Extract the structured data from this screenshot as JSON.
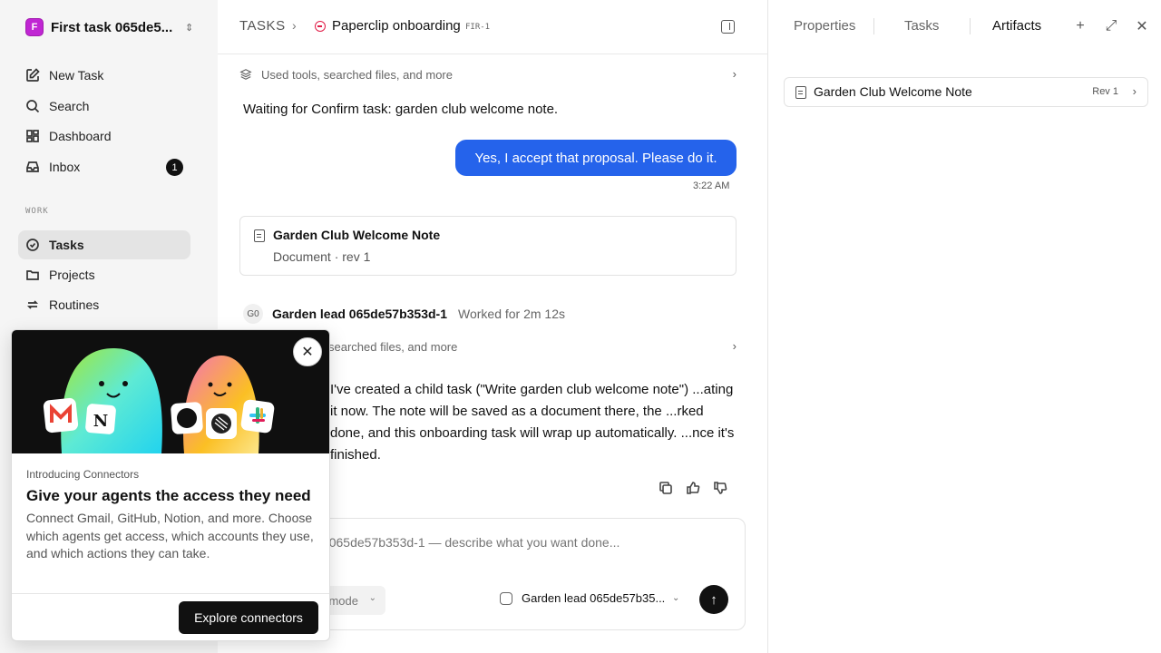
{
  "workspace": {
    "logo_letter": "F",
    "name": "First task 065de5..."
  },
  "sidebar": {
    "items": [
      {
        "label": "New Task",
        "icon": "edit-icon"
      },
      {
        "label": "Search",
        "icon": "search-icon"
      },
      {
        "label": "Dashboard",
        "icon": "dashboard-icon"
      },
      {
        "label": "Inbox",
        "icon": "inbox-icon",
        "badge": "1"
      }
    ],
    "section_label": "WORK",
    "work_items": [
      {
        "label": "Tasks",
        "icon": "check-circle-icon",
        "active": true
      },
      {
        "label": "Projects",
        "icon": "folder-icon"
      },
      {
        "label": "Routines",
        "icon": "repeat-icon"
      }
    ]
  },
  "header": {
    "breadcrumb_root": "TASKS",
    "task_title": "Paperclip onboarding",
    "task_id": "FIR-1",
    "status_color": "#e11d48"
  },
  "thread": {
    "tool_summary_1": "Used tools, searched files, and more",
    "waiting_text": "Waiting for Confirm task: garden club welcome note.",
    "user_message": "Yes, I accept that proposal. Please do it.",
    "user_message_time": "3:22 AM",
    "user_bubble_color": "#2563eb",
    "document_card": {
      "title": "Garden Club Welcome Note",
      "subtitle": "Document · rev 1"
    },
    "agent": {
      "initials": "G0",
      "name": "Garden lead 065de57b353d-1",
      "worked": "Worked for 2m 12s"
    },
    "tool_summary_2": "searched files, and more",
    "agent_message": "I've created a child task (\"Write garden club welcome note\") ...ating it now. The note will be saved as a document there, the ...rked done, and this onboarding task will wrap up automatically. ...nce it's finished."
  },
  "composer": {
    "placeholder": "...arden lead 065de57b353d-1 — describe what you want done...",
    "mode_label": "mode",
    "agent_label": "Garden lead 065de57b35..."
  },
  "right_panel": {
    "tabs": [
      "Properties",
      "Tasks",
      "Artifacts"
    ],
    "active_tab": "Artifacts",
    "artifact": {
      "name": "Garden Club Welcome Note",
      "rev": "Rev 1"
    }
  },
  "promo": {
    "kicker": "Introducing Connectors",
    "title": "Give your agents the access they need",
    "body": "Connect Gmail, GitHub, Notion, and more. Choose which agents get access, which accounts they use, and which actions they can take.",
    "cta": "Explore connectors"
  }
}
